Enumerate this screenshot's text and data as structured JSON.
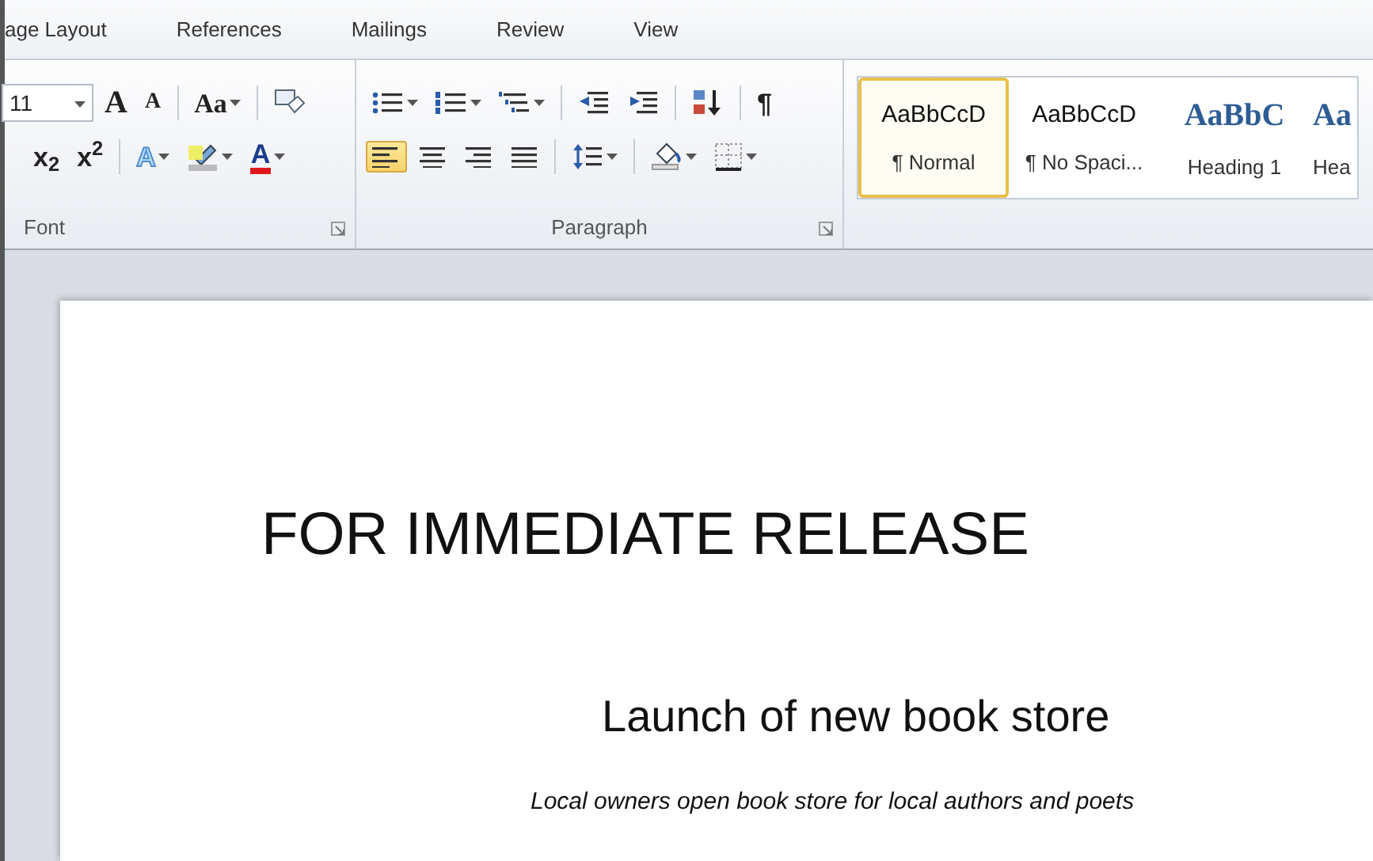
{
  "tabs": [
    {
      "label": "age Layout",
      "selected": false
    },
    {
      "label": "References",
      "selected": false
    },
    {
      "label": "Mailings",
      "selected": false
    },
    {
      "label": "Review",
      "selected": false
    },
    {
      "label": "View",
      "selected": false
    }
  ],
  "font_group": {
    "label": "Font",
    "font_size": "11",
    "row_1": [
      {
        "kind": "glyph",
        "glyph": "A",
        "dropdown": false
      },
      {
        "kind": "glyph",
        "glyph": "A",
        "dropdown": false
      },
      {
        "kind": "sep"
      },
      {
        "kind": "glyph",
        "glyph": "Aa",
        "dropdown": true
      },
      {
        "kind": "sep"
      },
      {
        "kind": "icon",
        "dropdown": false
      }
    ],
    "row_2": [
      {
        "kind": "glyph",
        "glyph": "x$_{2}$",
        "dropdown": false
      },
      {
        "kind": "glyph",
        "glyph": "x$^{2}$",
        "dropdown": false
      },
      {
        "kind": "sep"
      },
      {
        "kind": "glyph",
        "glyph": "A",
        "dropdown": true
      },
      {
        "kind": "icon",
        "dropdown": true
      },
      {
        "kind": "glyph",
        "glyph": "A",
        "dropdown": true
      }
    ]
  },
  "paragraph_group": {
    "label": "Paragraph",
    "row_1": [
      {
        "kind": "icon",
        "dropdown": true,
        "selected": false
      },
      {
        "kind": "icon",
        "dropdown": true,
        "selected": false
      },
      {
        "kind": "icon",
        "dropdown": true,
        "selected": false
      },
      {
        "kind": "sep"
      },
      {
        "kind": "icon",
        "dropdown": false,
        "selected": false
      },
      {
        "kind": "icon",
        "dropdown": false,
        "selected": false
      },
      {
        "kind": "sep"
      },
      {
        "kind": "icon",
        "dropdown": false,
        "selected": false
      },
      {
        "kind": "sep"
      },
      {
        "kind": "glyph",
        "glyph": "¶",
        "dropdown": false,
        "selected": false
      }
    ],
    "row_2": [
      {
        "kind": "icon",
        "dropdown": false,
        "selected": true
      },
      {
        "kind": "icon",
        "dropdown": false,
        "selected": false
      },
      {
        "kind": "icon",
        "dropdown": false,
        "selected": false
      },
      {
        "kind": "icon",
        "dropdown": false,
        "selected": false
      },
      {
        "kind": "sep"
      },
      {
        "kind": "icon",
        "dropdown": true,
        "selected": false
      },
      {
        "kind": "sep"
      },
      {
        "kind": "icon",
        "dropdown": true,
        "selected": false
      },
      {
        "kind": "icon",
        "dropdown": true,
        "selected": false
      }
    ]
  },
  "styles": [
    {
      "kind": "body",
      "preview": "AaBbCcD",
      "label": "¶ Normal",
      "selected": true
    },
    {
      "kind": "body",
      "preview": "AaBbCcD",
      "label": "¶ No Spaci...",
      "selected": false
    },
    {
      "kind": "heading",
      "preview": "AaBbC",
      "label": "Heading 1",
      "selected": false
    },
    {
      "kind": "heading",
      "preview": "Aa",
      "label": "Hea",
      "selected": false
    }
  ],
  "document": {
    "title": "FOR IMMEDIATE RELEASE",
    "headline": "Launch of new book store",
    "tagline": "Local owners open book store for local authors and poets"
  }
}
